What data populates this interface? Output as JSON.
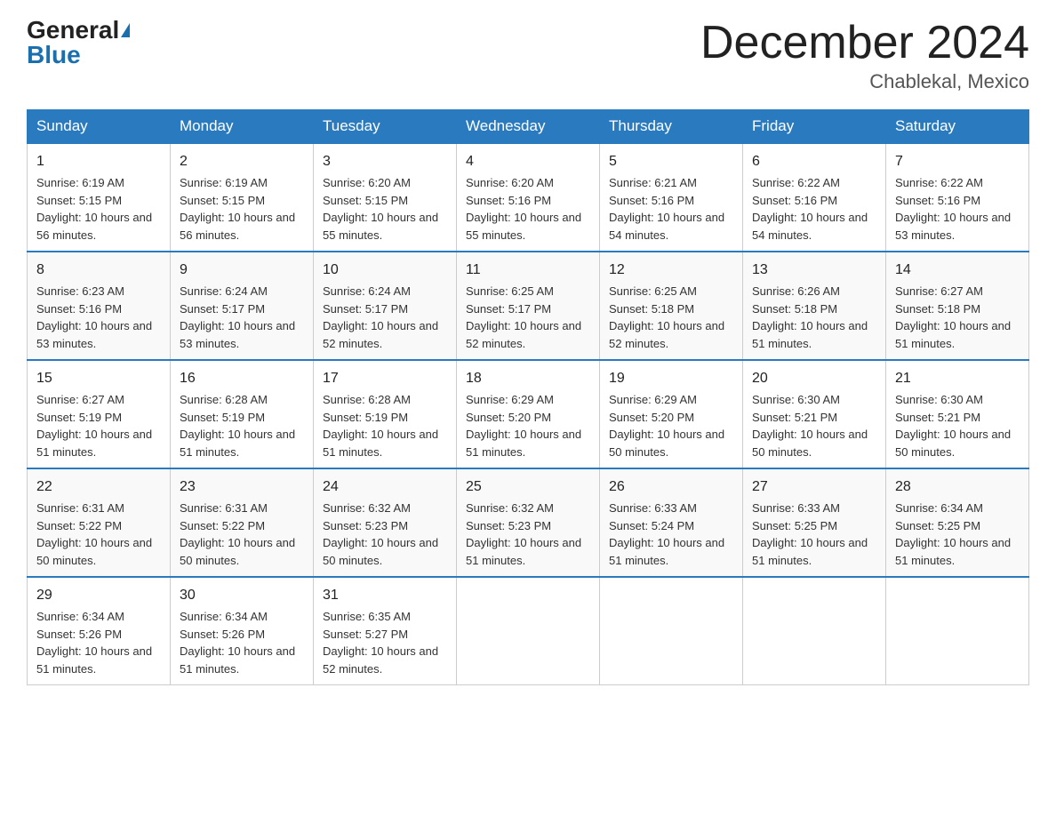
{
  "header": {
    "logo_general": "General",
    "logo_blue": "Blue",
    "month_year": "December 2024",
    "location": "Chablekal, Mexico"
  },
  "weekdays": [
    "Sunday",
    "Monday",
    "Tuesday",
    "Wednesday",
    "Thursday",
    "Friday",
    "Saturday"
  ],
  "weeks": [
    [
      {
        "day": "1",
        "sunrise": "6:19 AM",
        "sunset": "5:15 PM",
        "daylight": "10 hours and 56 minutes."
      },
      {
        "day": "2",
        "sunrise": "6:19 AM",
        "sunset": "5:15 PM",
        "daylight": "10 hours and 56 minutes."
      },
      {
        "day": "3",
        "sunrise": "6:20 AM",
        "sunset": "5:15 PM",
        "daylight": "10 hours and 55 minutes."
      },
      {
        "day": "4",
        "sunrise": "6:20 AM",
        "sunset": "5:16 PM",
        "daylight": "10 hours and 55 minutes."
      },
      {
        "day": "5",
        "sunrise": "6:21 AM",
        "sunset": "5:16 PM",
        "daylight": "10 hours and 54 minutes."
      },
      {
        "day": "6",
        "sunrise": "6:22 AM",
        "sunset": "5:16 PM",
        "daylight": "10 hours and 54 minutes."
      },
      {
        "day": "7",
        "sunrise": "6:22 AM",
        "sunset": "5:16 PM",
        "daylight": "10 hours and 53 minutes."
      }
    ],
    [
      {
        "day": "8",
        "sunrise": "6:23 AM",
        "sunset": "5:16 PM",
        "daylight": "10 hours and 53 minutes."
      },
      {
        "day": "9",
        "sunrise": "6:24 AM",
        "sunset": "5:17 PM",
        "daylight": "10 hours and 53 minutes."
      },
      {
        "day": "10",
        "sunrise": "6:24 AM",
        "sunset": "5:17 PM",
        "daylight": "10 hours and 52 minutes."
      },
      {
        "day": "11",
        "sunrise": "6:25 AM",
        "sunset": "5:17 PM",
        "daylight": "10 hours and 52 minutes."
      },
      {
        "day": "12",
        "sunrise": "6:25 AM",
        "sunset": "5:18 PM",
        "daylight": "10 hours and 52 minutes."
      },
      {
        "day": "13",
        "sunrise": "6:26 AM",
        "sunset": "5:18 PM",
        "daylight": "10 hours and 51 minutes."
      },
      {
        "day": "14",
        "sunrise": "6:27 AM",
        "sunset": "5:18 PM",
        "daylight": "10 hours and 51 minutes."
      }
    ],
    [
      {
        "day": "15",
        "sunrise": "6:27 AM",
        "sunset": "5:19 PM",
        "daylight": "10 hours and 51 minutes."
      },
      {
        "day": "16",
        "sunrise": "6:28 AM",
        "sunset": "5:19 PM",
        "daylight": "10 hours and 51 minutes."
      },
      {
        "day": "17",
        "sunrise": "6:28 AM",
        "sunset": "5:19 PM",
        "daylight": "10 hours and 51 minutes."
      },
      {
        "day": "18",
        "sunrise": "6:29 AM",
        "sunset": "5:20 PM",
        "daylight": "10 hours and 51 minutes."
      },
      {
        "day": "19",
        "sunrise": "6:29 AM",
        "sunset": "5:20 PM",
        "daylight": "10 hours and 50 minutes."
      },
      {
        "day": "20",
        "sunrise": "6:30 AM",
        "sunset": "5:21 PM",
        "daylight": "10 hours and 50 minutes."
      },
      {
        "day": "21",
        "sunrise": "6:30 AM",
        "sunset": "5:21 PM",
        "daylight": "10 hours and 50 minutes."
      }
    ],
    [
      {
        "day": "22",
        "sunrise": "6:31 AM",
        "sunset": "5:22 PM",
        "daylight": "10 hours and 50 minutes."
      },
      {
        "day": "23",
        "sunrise": "6:31 AM",
        "sunset": "5:22 PM",
        "daylight": "10 hours and 50 minutes."
      },
      {
        "day": "24",
        "sunrise": "6:32 AM",
        "sunset": "5:23 PM",
        "daylight": "10 hours and 50 minutes."
      },
      {
        "day": "25",
        "sunrise": "6:32 AM",
        "sunset": "5:23 PM",
        "daylight": "10 hours and 51 minutes."
      },
      {
        "day": "26",
        "sunrise": "6:33 AM",
        "sunset": "5:24 PM",
        "daylight": "10 hours and 51 minutes."
      },
      {
        "day": "27",
        "sunrise": "6:33 AM",
        "sunset": "5:25 PM",
        "daylight": "10 hours and 51 minutes."
      },
      {
        "day": "28",
        "sunrise": "6:34 AM",
        "sunset": "5:25 PM",
        "daylight": "10 hours and 51 minutes."
      }
    ],
    [
      {
        "day": "29",
        "sunrise": "6:34 AM",
        "sunset": "5:26 PM",
        "daylight": "10 hours and 51 minutes."
      },
      {
        "day": "30",
        "sunrise": "6:34 AM",
        "sunset": "5:26 PM",
        "daylight": "10 hours and 51 minutes."
      },
      {
        "day": "31",
        "sunrise": "6:35 AM",
        "sunset": "5:27 PM",
        "daylight": "10 hours and 52 minutes."
      },
      null,
      null,
      null,
      null
    ]
  ]
}
